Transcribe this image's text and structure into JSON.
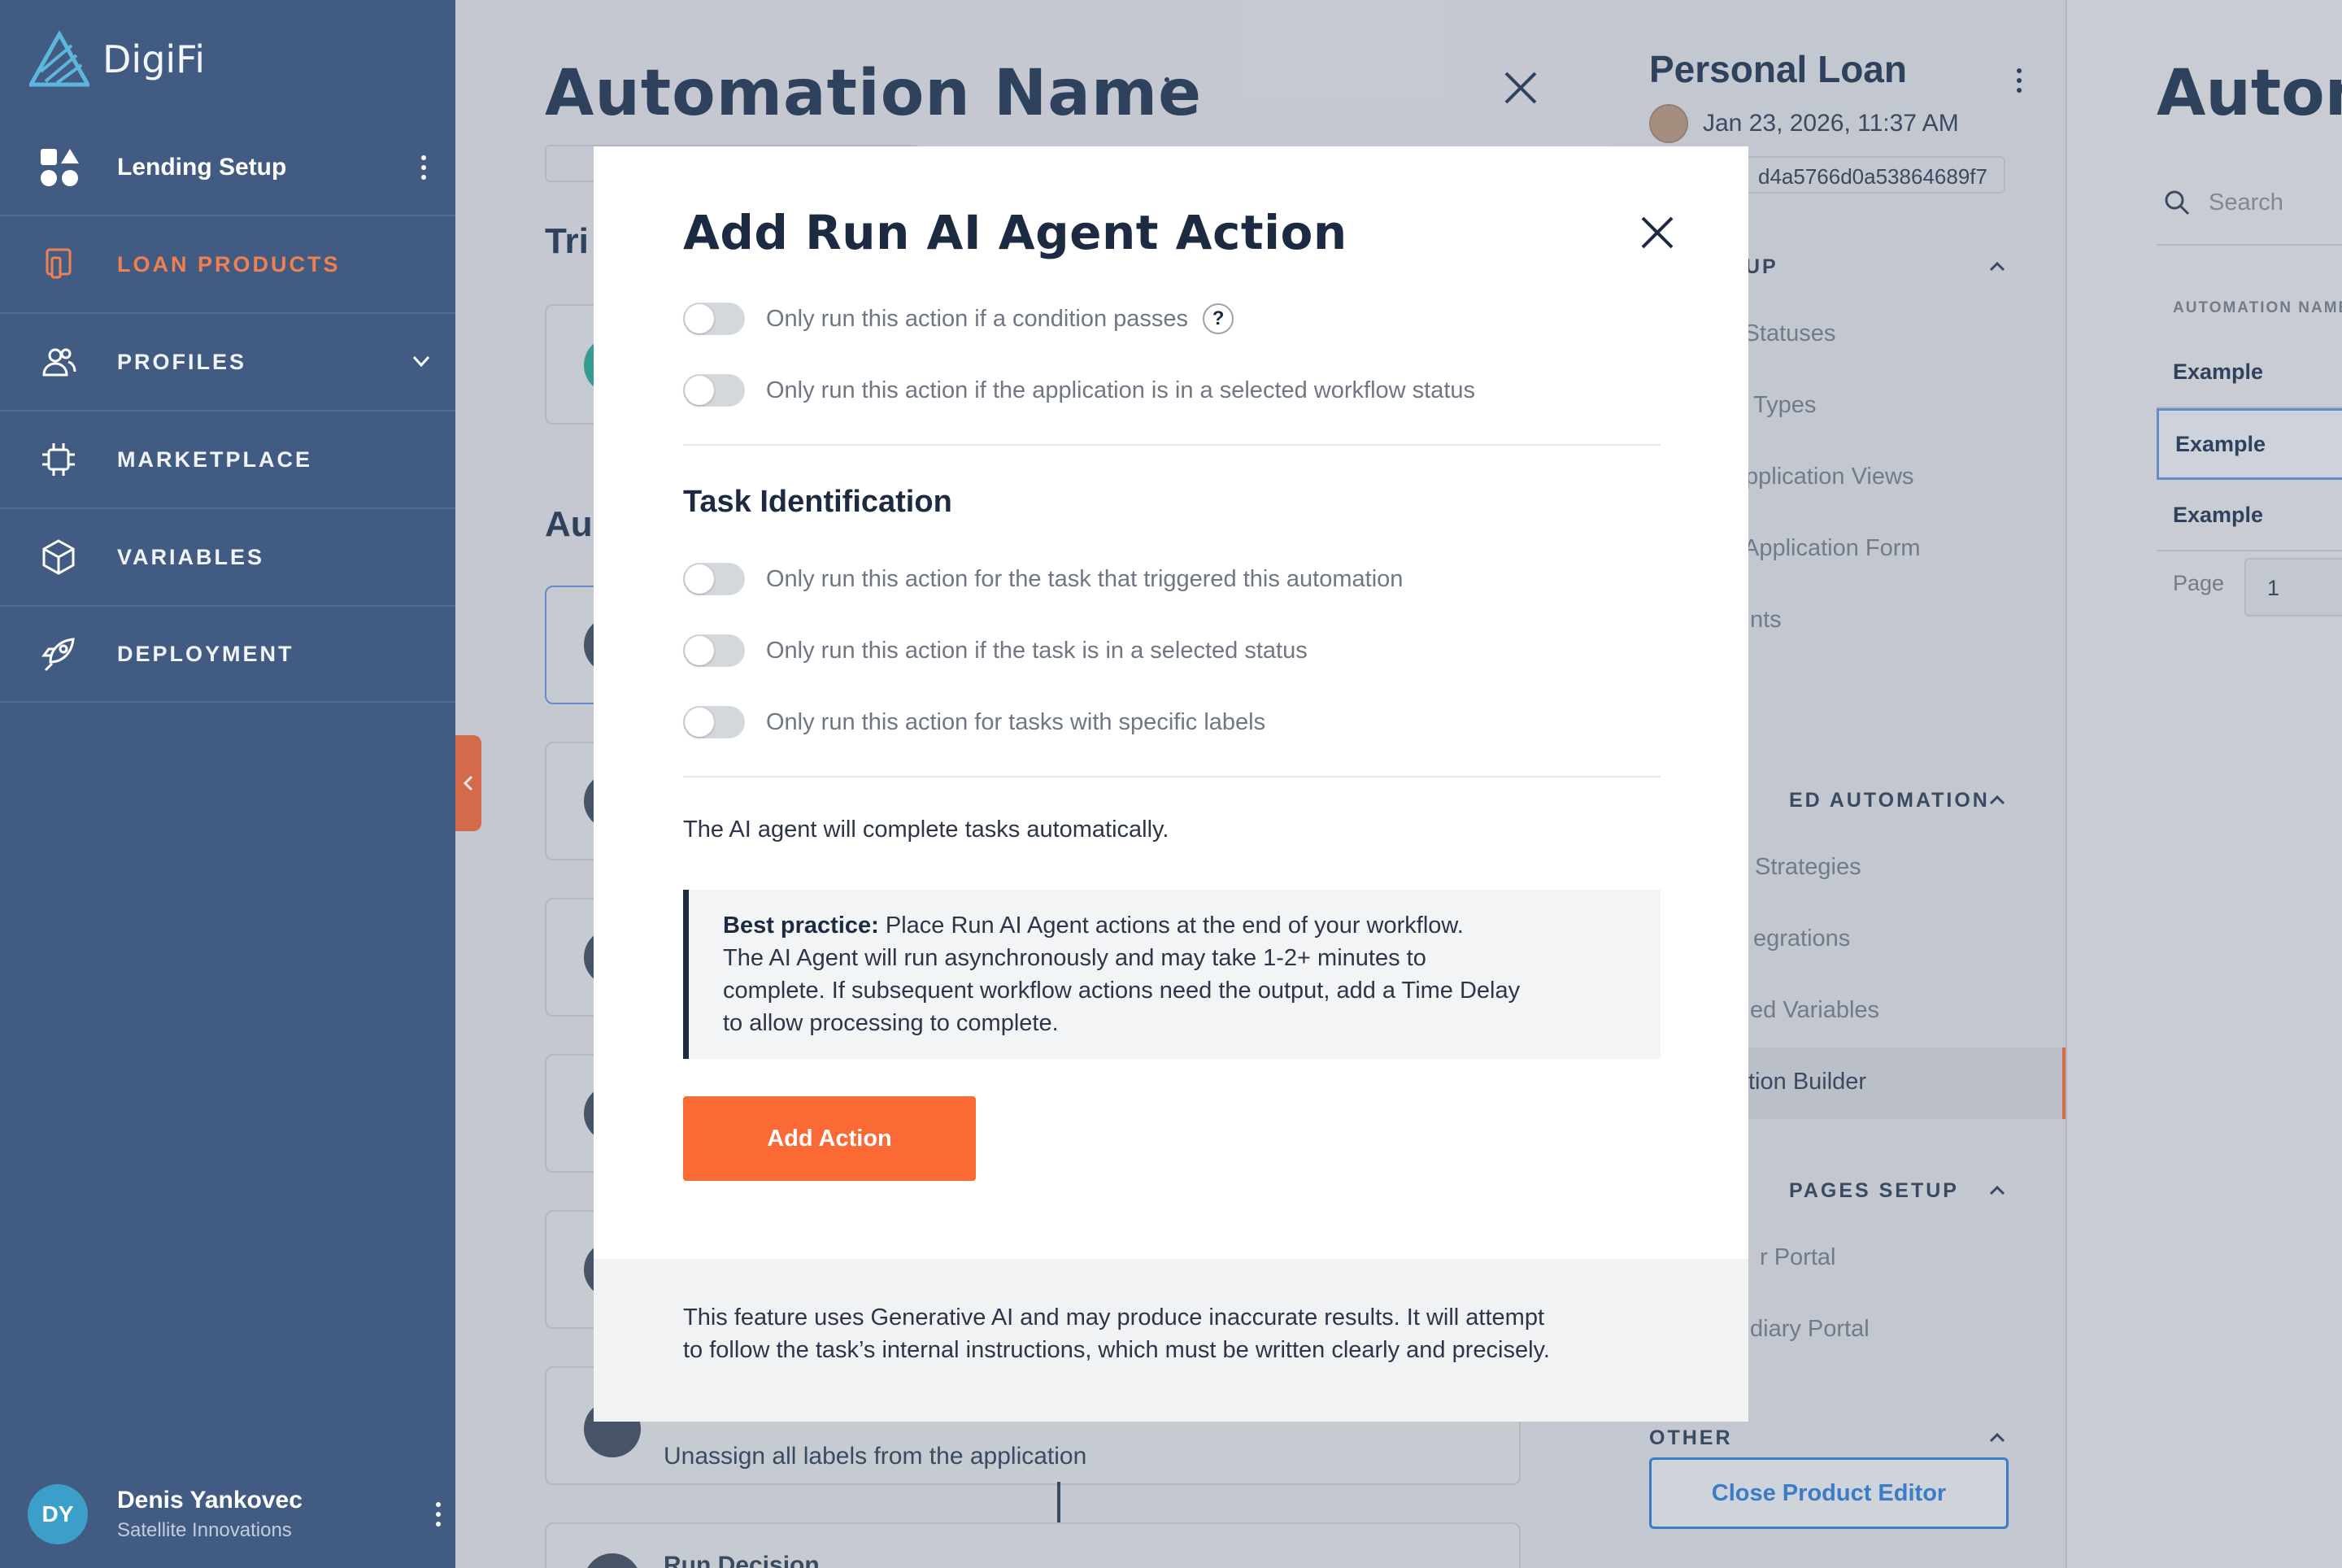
{
  "app": {
    "logo_text": "DigiFi",
    "workspace_label": "Lending Setup"
  },
  "sidebar": {
    "items": [
      {
        "label": "LOAN PRODUCTS",
        "icon": "loan-products-icon",
        "active": true
      },
      {
        "label": "PROFILES",
        "icon": "profiles-icon",
        "expandable": true
      },
      {
        "label": "MARKETPLACE",
        "icon": "marketplace-icon"
      },
      {
        "label": "VARIABLES",
        "icon": "variables-icon"
      },
      {
        "label": "DEPLOYMENT",
        "icon": "deployment-icon"
      }
    ],
    "user": {
      "initials": "DY",
      "name": "Denis Yankovec",
      "org": "Satellite Innovations"
    }
  },
  "background": {
    "title": "Automation Name",
    "section_trigger": "Tri",
    "section_actions": "Au",
    "card_unassign": "Unassign all labels from the application",
    "card_run_decision": "Run Decision"
  },
  "product_panel": {
    "title": "Personal Loan",
    "date": "Jan 23, 2026, 11:37 AM",
    "id_fragment": "d4a5766d0a53864689f7",
    "sections": {
      "setup": "ETUP",
      "automation": "ED AUTOMATION",
      "pages": "PAGES SETUP",
      "other": "OTHER"
    },
    "setup_items": [
      "v Statuses",
      "Types",
      "pplication Views",
      "Application Form",
      "nts"
    ],
    "automation_items": [
      "Strategies",
      "egrations",
      "ed Variables",
      "tion Builder"
    ],
    "pages_items": [
      "r Portal",
      "diary Portal"
    ],
    "close_button": "Close Product Editor"
  },
  "automations_list": {
    "title": "Autom",
    "search_placeholder": "Search",
    "column_header": "AUTOMATION NAME",
    "rows": [
      "Example",
      "Example",
      "Example"
    ],
    "page_label": "Page",
    "page_value": "1"
  },
  "modal": {
    "title": "Add Run AI Agent Action",
    "toggle_condition": "Only run this action if a condition passes",
    "help_glyph": "?",
    "toggle_status": "Only run this action if the application is in a selected workflow status",
    "task_section_title": "Task Identification",
    "toggle_task_trigger": "Only run this action for the task that triggered this automation",
    "toggle_task_status": "Only run this action if the task is in a selected status",
    "toggle_task_labels": "Only run this action for tasks with specific labels",
    "info_text": "The AI agent will complete tasks automatically.",
    "callout_bold": "Best practice:",
    "callout_line1": " Place Run AI Agent actions at the end of your workflow.",
    "callout_line2": "The AI Agent will run asynchronously and may take 1-2+ minutes to",
    "callout_line3": "complete. If subsequent workflow actions need the output, add a Time Delay",
    "callout_line4": "to allow processing to complete.",
    "add_button": "Add Action",
    "footer_line1": "This feature uses Generative AI and may produce inaccurate results. It will attempt",
    "footer_line2": "to follow the task’s internal instructions, which must be written clearly and precisely."
  },
  "colors": {
    "sidebar_bg": "#415b83",
    "accent_orange": "#fb6a34",
    "active_nav": "#f08050",
    "link_blue": "#3f86d9",
    "navy_text": "#1d2b42"
  }
}
